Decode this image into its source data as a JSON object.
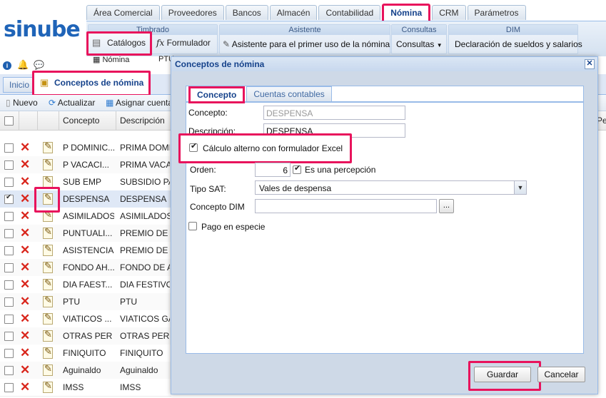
{
  "logo": "sinube",
  "main_tabs": [
    "Área Comercial",
    "Proveedores",
    "Bancos",
    "Almacén",
    "Contabilidad",
    "Nómina",
    "CRM",
    "Parámetros"
  ],
  "ribbon": {
    "timbrado_title": "Timbrado",
    "catalogos": "Catálogos",
    "formulador": "Formulador",
    "nomina": "Nómina",
    "ptu_partial": "PTU",
    "asistente_title": "Asistente",
    "asistente_btn": "Asistente para el primer uso de la nómina",
    "consultas_title": "Consultas",
    "consultas_btn": "Consultas",
    "dim_title": "DIM",
    "dim_btn": "Declaración de sueldos y salarios"
  },
  "page_tabs": {
    "inicio": "Inicio",
    "conceptos": "Conceptos de nómina"
  },
  "toolbar": {
    "nuevo": "Nuevo",
    "actualizar": "Actualizar",
    "asignar": "Asignar cuenta"
  },
  "grid": {
    "col_concepto": "Concepto",
    "col_descripcion": "Descripción",
    "col_per": "Per",
    "rows": [
      {
        "concepto": "P DOMINIC...",
        "descripcion": "PRIMA DOMI"
      },
      {
        "concepto": "P VACACI...",
        "descripcion": "PRIMA VACAC"
      },
      {
        "concepto": "SUB EMP",
        "descripcion": "SUBSIDIO PA"
      },
      {
        "concepto": "DESPENSA",
        "descripcion": "DESPENSA"
      },
      {
        "concepto": "ASIMILADOS",
        "descripcion": "ASIMILADOS"
      },
      {
        "concepto": "PUNTUALI...",
        "descripcion": "PREMIO DE P"
      },
      {
        "concepto": "ASISTENCIA",
        "descripcion": "PREMIO DE A"
      },
      {
        "concepto": "FONDO AH...",
        "descripcion": "FONDO DE AI"
      },
      {
        "concepto": "DIA FAEST...",
        "descripcion": "DIA FESTIVO"
      },
      {
        "concepto": "PTU",
        "descripcion": "PTU"
      },
      {
        "concepto": "VIATICOS ...",
        "descripcion": "VIATICOS GA"
      },
      {
        "concepto": "OTRAS PER",
        "descripcion": "OTRAS PERC"
      },
      {
        "concepto": "FINIQUITO",
        "descripcion": "FINIQUITO"
      },
      {
        "concepto": "Aguinaldo",
        "descripcion": "Aguinaldo"
      },
      {
        "concepto": "IMSS",
        "descripcion": "IMSS"
      }
    ]
  },
  "dialog": {
    "title": "Conceptos de nómina",
    "tab_concepto": "Concepto",
    "tab_cuentas": "Cuentas contables",
    "concepto_label": "Concepto:",
    "concepto_value": "DESPENSA",
    "descripcion_label": "Descripción:",
    "descripcion_value": "DESPENSA",
    "calculo_label": "Cálculo alterno con formulador Excel",
    "orden_label": "Orden:",
    "orden_value": "6",
    "percepcion_label": "Es una percepción",
    "tipo_sat_label": "Tipo SAT:",
    "tipo_sat_value": "Vales de despensa",
    "dim_label": "Concepto DIM",
    "dim_value": "",
    "browse_label": "...",
    "pago_label": "Pago en especie",
    "guardar": "Guardar",
    "cancelar": "Cancelar"
  }
}
